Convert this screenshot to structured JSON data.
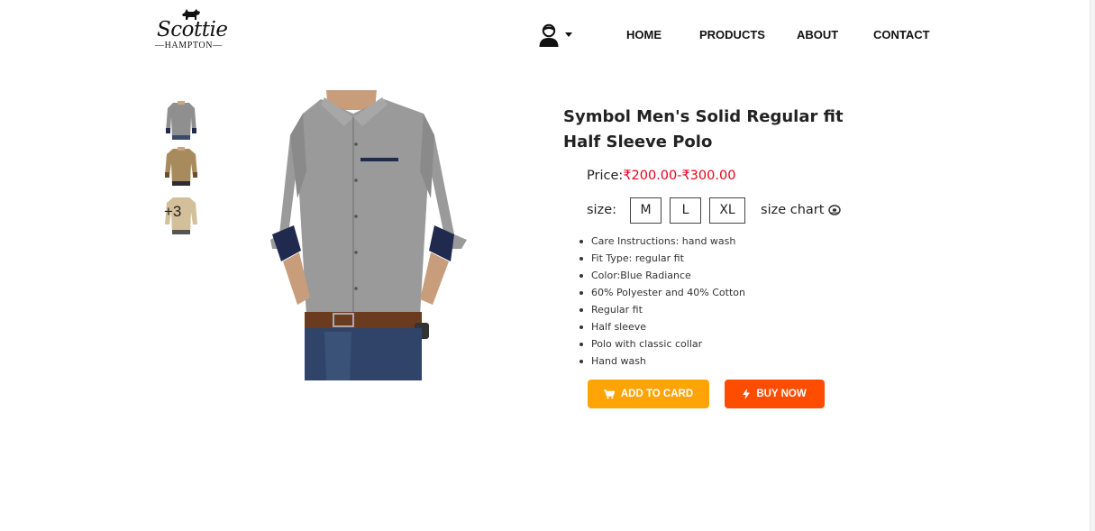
{
  "brand": {
    "script": "Scottie",
    "subtitle": "—HAMPTON—"
  },
  "header": {
    "user_icon": "user-avatar-icon",
    "nav": [
      {
        "label": "HOME"
      },
      {
        "label": "PRODUCTS"
      },
      {
        "label": "ABOUT"
      },
      {
        "label": "CONTACT"
      }
    ]
  },
  "gallery": {
    "more_label": "+3"
  },
  "product": {
    "title": "Symbol Men's Solid Regular fit Half Sleeve Polo",
    "price_label": "Price:",
    "price_value": "₹200.00-₹300.00",
    "size_label": "size:",
    "sizes": [
      "M",
      "L",
      "XL"
    ],
    "size_chart_label": "size chart",
    "features": [
      "Care Instructions: hand wash",
      "Fit Type: regular fit",
      "Color:Blue Radiance",
      "60% Polyester and 40% Cotton",
      "Regular fit",
      "Half sleeve",
      "Polo with classic collar",
      "Hand wash"
    ]
  },
  "actions": {
    "add_to_cart": "ADD TO CARD",
    "buy_now": "BUY NOW"
  },
  "colors": {
    "price": "#e8001b",
    "add_to_cart": "#ffa406",
    "buy_now": "#fe4c01",
    "shirt": "#9a9a9a",
    "cuff": "#1f2a4e"
  }
}
